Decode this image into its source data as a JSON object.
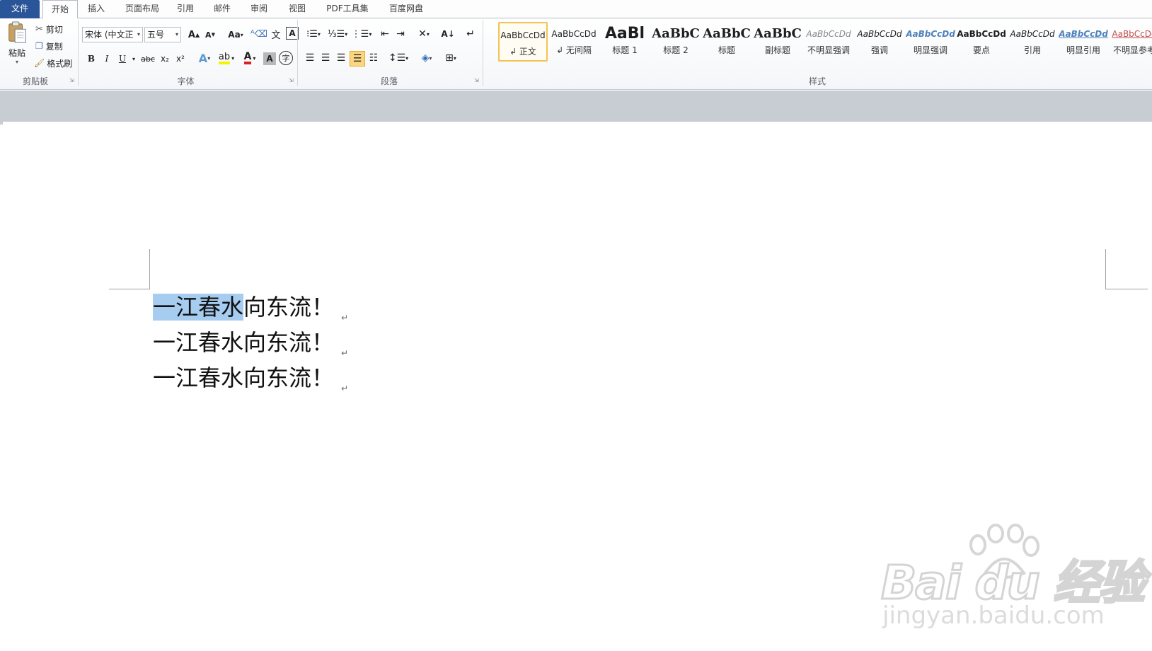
{
  "tabs": {
    "file": "文件",
    "home": "开始",
    "insert": "插入",
    "page_layout": "页面布局",
    "references": "引用",
    "mailings": "邮件",
    "review": "审阅",
    "view": "视图",
    "pdf_tools": "PDF工具集",
    "baidu_netdisk": "百度网盘"
  },
  "clipboard": {
    "paste": "粘贴",
    "cut": "剪切",
    "copy": "复制",
    "format_painter": "格式刷",
    "group_label": "剪贴板"
  },
  "font": {
    "font_name": "宋体 (中文正",
    "font_size": "五号",
    "change_case": "Aa",
    "bold": "B",
    "italic": "I",
    "underline": "U",
    "strikethrough": "abc",
    "subscript": "x₂",
    "superscript": "x²",
    "group_label": "字体"
  },
  "paragraph": {
    "group_label": "段落"
  },
  "styles": {
    "group_label": "样式",
    "items": [
      {
        "preview": "AaBbCcDd",
        "name": "↲ 正文"
      },
      {
        "preview": "AaBbCcDd",
        "name": "↲ 无间隔"
      },
      {
        "preview": "AaBl",
        "name": "标题 1"
      },
      {
        "preview": "AaBbC",
        "name": "标题 2"
      },
      {
        "preview": "AaBbC",
        "name": "标题"
      },
      {
        "preview": "AaBbC",
        "name": "副标题"
      },
      {
        "preview": "AaBbCcDd",
        "name": "不明显强调"
      },
      {
        "preview": "AaBbCcDd",
        "name": "强调"
      },
      {
        "preview": "AaBbCcDd",
        "name": "明显强调"
      },
      {
        "preview": "AaBbCcDd",
        "name": "要点"
      },
      {
        "preview": "AaBbCcDd",
        "name": "引用"
      },
      {
        "preview": "AaBbCcDd",
        "name": "明显引用"
      },
      {
        "preview": "AaBbCcDd",
        "name": "不明显参考"
      }
    ]
  },
  "document": {
    "lines": [
      {
        "selected": "一江春水",
        "rest": "向东流！",
        "mark": "↵"
      },
      {
        "selected": "",
        "rest": "一江春水向东流！",
        "mark": "↵"
      },
      {
        "selected": "",
        "rest": "一江春水向东流！",
        "mark": "↵"
      }
    ],
    "selection_color": "#a6ccf0"
  },
  "watermark": {
    "brand": "Bai du 经验",
    "url": "jingyan.baidu.com"
  },
  "colors": {
    "file_tab": "#2a5699",
    "selected_style_border": "#f2c452",
    "doc_background": "#c8ccd3",
    "font_color_red": "#e02020",
    "highlight_yellow": "#f5f500"
  }
}
